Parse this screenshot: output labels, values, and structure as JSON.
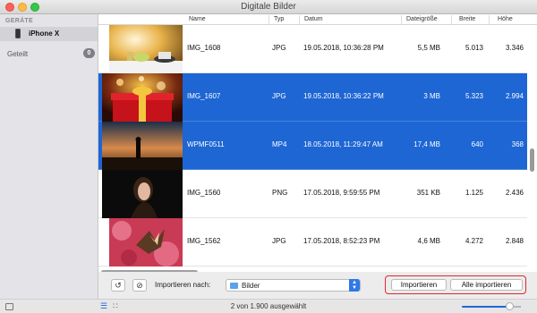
{
  "window": {
    "title": "Digitale Bilder"
  },
  "sidebar": {
    "section_title": "GERÄTE",
    "device_label": "iPhone X",
    "shared_label": "Geteilt",
    "shared_count": "0"
  },
  "table": {
    "columns": {
      "name": "Name",
      "type": "Typ",
      "date": "Datum",
      "size": "Dateigröße",
      "width": "Breite",
      "height": "Höhe"
    },
    "rows": [
      {
        "name": "IMG_1608",
        "type": "JPG",
        "date": "19.05.2018, 10:36:28 PM",
        "size": "5,5 MB",
        "width": "5.013",
        "height": "3.346",
        "selected": false
      },
      {
        "name": "IMG_1607",
        "type": "JPG",
        "date": "19.05.2018, 10:36:22 PM",
        "size": "3 MB",
        "width": "5.323",
        "height": "2.994",
        "selected": true
      },
      {
        "name": "WPMF0511",
        "type": "MP4",
        "date": "18.05.2018, 11:29:47 AM",
        "size": "17,4 MB",
        "width": "640",
        "height": "368",
        "selected": true
      },
      {
        "name": "IMG_1560",
        "type": "PNG",
        "date": "17.05.2018, 9:59:55 PM",
        "size": "351 KB",
        "width": "1.125",
        "height": "2.436",
        "selected": false
      },
      {
        "name": "IMG_1562",
        "type": "JPG",
        "date": "17.05.2018, 8:52:23 PM",
        "size": "4,6 MB",
        "width": "4.272",
        "height": "2.848",
        "selected": false
      }
    ]
  },
  "toolbar": {
    "rotate_icon": "rotate-icon",
    "delete_icon": "no-entry-icon",
    "import_to_label": "Importieren nach:",
    "destination_folder": "Bilder",
    "import_button": "Importieren",
    "import_all_button": "Alle importieren",
    "highlight_color": "#e0272f"
  },
  "status": {
    "selection_text": "2 von 1.900 ausgewählt",
    "accent_color": "#1d66d4"
  }
}
